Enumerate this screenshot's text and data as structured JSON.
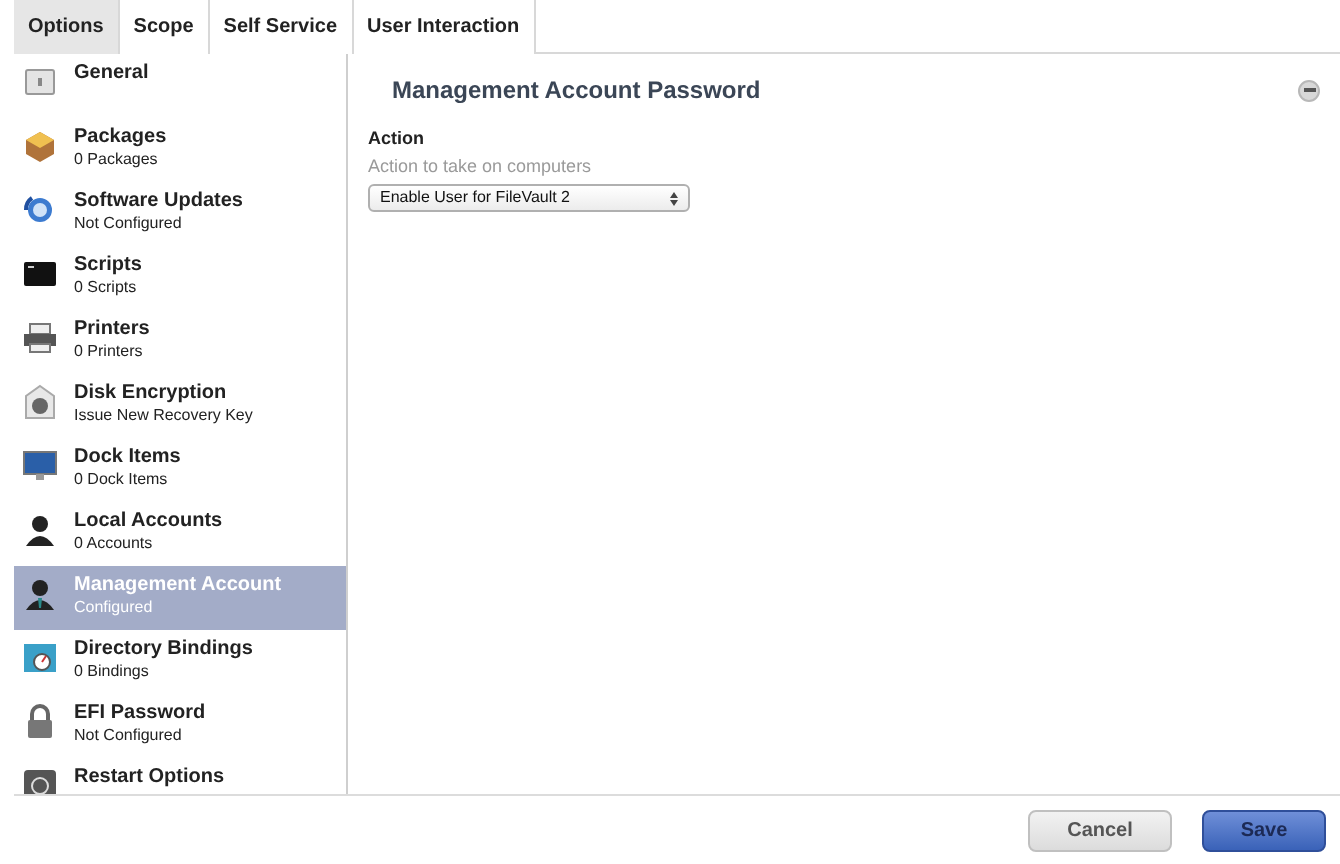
{
  "tabs": [
    {
      "label": "Options",
      "selected": true
    },
    {
      "label": "Scope",
      "selected": false
    },
    {
      "label": "Self Service",
      "selected": false
    },
    {
      "label": "User Interaction",
      "selected": false
    }
  ],
  "sidebar": {
    "items": [
      {
        "title": "General",
        "selected": false
      },
      {
        "title": "Packages",
        "subtitle": "0 Packages",
        "selected": false
      },
      {
        "title": "Software Updates",
        "subtitle": "Not Configured",
        "selected": false
      },
      {
        "title": "Scripts",
        "subtitle": "0 Scripts",
        "selected": false
      },
      {
        "title": "Printers",
        "subtitle": "0 Printers",
        "selected": false
      },
      {
        "title": "Disk Encryption",
        "subtitle": "Issue New Recovery Key",
        "selected": false
      },
      {
        "title": "Dock Items",
        "subtitle": "0 Dock Items",
        "selected": false
      },
      {
        "title": "Local Accounts",
        "subtitle": "0 Accounts",
        "selected": false
      },
      {
        "title": "Management Account",
        "subtitle": "Configured",
        "selected": true
      },
      {
        "title": "Directory Bindings",
        "subtitle": "0 Bindings",
        "selected": false
      },
      {
        "title": "EFI Password",
        "subtitle": "Not Configured",
        "selected": false
      },
      {
        "title": "Restart Options",
        "selected": false
      }
    ]
  },
  "panel": {
    "title": "Management Account Password",
    "field": {
      "label": "Action",
      "hint": "Action to take on computers",
      "value": "Enable User for FileVault 2"
    }
  },
  "buttons": [
    {
      "label": "Cancel",
      "kind": "secondary"
    },
    {
      "label": "Save",
      "kind": "primary"
    }
  ]
}
